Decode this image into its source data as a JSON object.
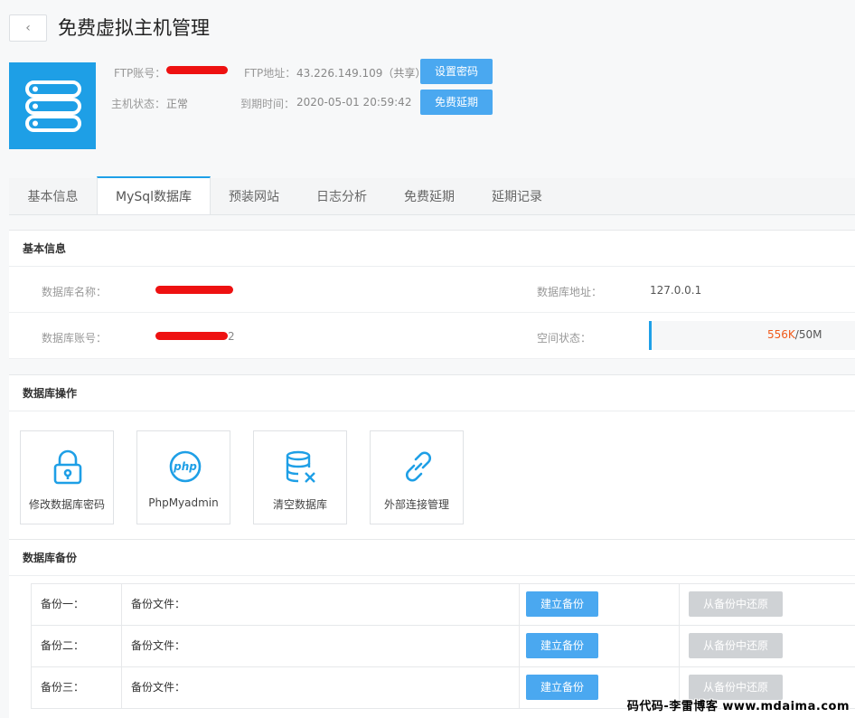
{
  "header": {
    "back_label": "‹",
    "title": "免费虚拟主机管理"
  },
  "host": {
    "icon": "server-icon",
    "ftp_account_label": "FTP账号：",
    "ftp_address_label": "FTP地址：",
    "ftp_address_value": "43.226.149.109（共享）",
    "status_label": "主机状态：",
    "status_value": "正常",
    "expire_label": "到期时间：",
    "expire_value": "2020-05-01 20:59:42",
    "set_password_button": "设置密码",
    "free_extend_button": "免费延期"
  },
  "tabs": [
    {
      "label": "基本信息",
      "active": false
    },
    {
      "label": "MySql数据库",
      "active": true
    },
    {
      "label": "预装网站",
      "active": false
    },
    {
      "label": "日志分析",
      "active": false
    },
    {
      "label": "免费延期",
      "active": false
    },
    {
      "label": "延期记录",
      "active": false
    }
  ],
  "basic_info": {
    "title": "基本信息",
    "db_name_label": "数据库名称：",
    "db_address_label": "数据库地址：",
    "db_address_value": "127.0.0.1",
    "db_account_label": "数据库账号：",
    "db_account_tail": "2",
    "space_label": "空间状态：",
    "space_used": "556K",
    "space_total": "/50M",
    "space_used_color": "#f05a1a"
  },
  "operations": {
    "title": "数据库操作",
    "items": [
      {
        "label": "修改数据库密码",
        "icon": "lock-icon"
      },
      {
        "label": "PhpMyadmin",
        "icon": "php-icon"
      },
      {
        "label": "清空数据库",
        "icon": "database-clear-icon"
      },
      {
        "label": "外部连接管理",
        "icon": "link-icon"
      }
    ]
  },
  "backup": {
    "title": "数据库备份",
    "file_label": "备份文件：",
    "create_label": "建立备份",
    "restore_label": "从备份中还原",
    "rows": [
      {
        "name": "备份一："
      },
      {
        "name": "备份二："
      },
      {
        "name": "备份三："
      }
    ]
  },
  "watermark": "码代码-李雷博客 www.mdaima.com",
  "colors": {
    "accent": "#1ea0e8",
    "button": "#4aa8f0",
    "disabled": "#cfd2d5"
  }
}
